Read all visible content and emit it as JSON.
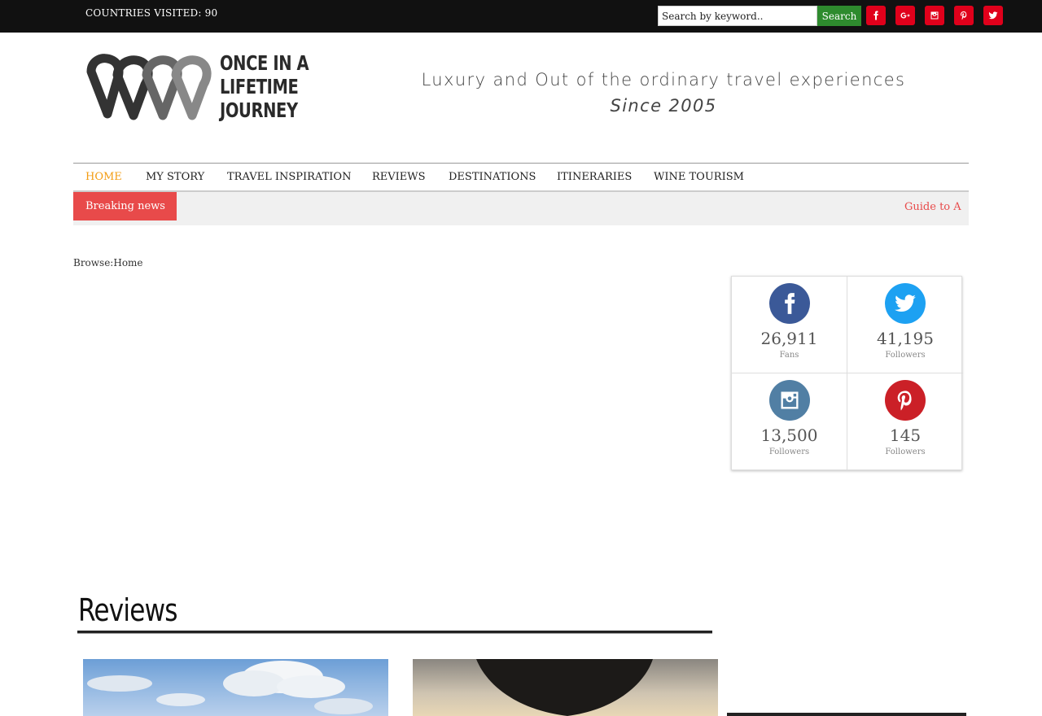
{
  "topbar": {
    "countries_visited": "COUNTRIES VISITED: 90",
    "search_placeholder": "Search by keyword..",
    "search_button": "Search",
    "social_icons": [
      "facebook-icon",
      "google-plus-icon",
      "instagram-icon",
      "pinterest-icon",
      "twitter-icon"
    ],
    "social_color": "#e0001b"
  },
  "header": {
    "logo_lines": [
      "ONCE IN A",
      "LIFETIME",
      "JOURNEY"
    ],
    "tagline": "Luxury and Out of the ordinary travel experiences",
    "since": "Since 2005"
  },
  "nav": {
    "items": [
      {
        "label": "HOME",
        "active": true
      },
      {
        "label": "MY STORY"
      },
      {
        "label": "TRAVEL INSPIRATION"
      },
      {
        "label": "REVIEWS"
      },
      {
        "label": "DESTINATIONS"
      },
      {
        "label": "ITINERARIES"
      },
      {
        "label": "WINE TOURISM"
      }
    ],
    "active_color": "#f39c12"
  },
  "breaking": {
    "label": "Breaking news",
    "ticker": "Guide to A",
    "accent_color": "#e84a4a"
  },
  "breadcrumb": {
    "prefix": "Browse:",
    "home": "Home"
  },
  "social_counters": [
    {
      "network": "facebook",
      "icon": "facebook-icon",
      "color": "#3b5998",
      "count": "26,911",
      "label": "Fans"
    },
    {
      "network": "twitter",
      "icon": "twitter-icon",
      "color": "#1da1f2",
      "count": "41,195",
      "label": "Followers"
    },
    {
      "network": "instagram",
      "icon": "instagram-icon",
      "color": "#517fa4",
      "count": "13,500",
      "label": "Followers"
    },
    {
      "network": "pinterest",
      "icon": "pinterest-icon",
      "color": "#cb2027",
      "count": "145",
      "label": "Followers"
    }
  ],
  "reviews": {
    "title": "Reviews"
  }
}
